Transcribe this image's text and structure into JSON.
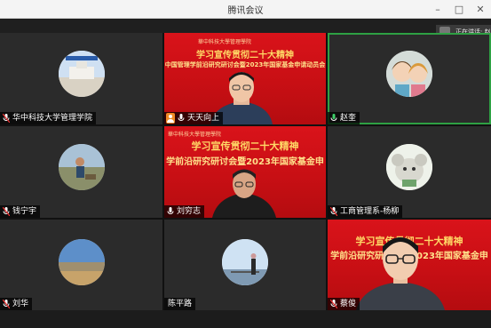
{
  "window": {
    "title": "腾讯会议",
    "controls": {
      "minimize": "–",
      "maximize": "□",
      "close": "✕"
    }
  },
  "speaking_indicator": {
    "text": "正在讲话: 赵"
  },
  "colors": {
    "speaking_border": "#2ea043",
    "banner_red": "#d9131a",
    "banner_gold": "#ffd966"
  },
  "banner": {
    "line1": "学习宣传贯彻二十大精神",
    "line2a": "中国管理学前沿研究研讨会暨2023年国家基金申请动员会",
    "line2b": "学前沿研究研讨会暨2023年国家基金申",
    "line2c": "学前沿研究研讨会暨2023年国家基金申",
    "logo_text": "華中科技大學管理學院"
  },
  "participants": [
    {
      "name": "华中科技大学管理学院",
      "muted": true,
      "icon": "mic-muted-icon"
    },
    {
      "name": "天天向上",
      "muted": false,
      "icon": "person-icon"
    },
    {
      "name": "赵奎",
      "muted": false,
      "icon": "mic-icon"
    },
    {
      "name": "钱宁宇",
      "muted": true,
      "icon": "mic-muted-icon"
    },
    {
      "name": "刘穷志",
      "muted": false,
      "icon": "mic-icon"
    },
    {
      "name": "工商管理系-杨柳",
      "muted": true,
      "icon": "mic-muted-icon"
    },
    {
      "name": "刘华",
      "muted": true,
      "icon": "mic-muted-icon"
    },
    {
      "name": "陈平路",
      "muted": false,
      "icon": "none"
    },
    {
      "name": "蔡俊",
      "muted": true,
      "icon": "mic-muted-icon"
    }
  ]
}
